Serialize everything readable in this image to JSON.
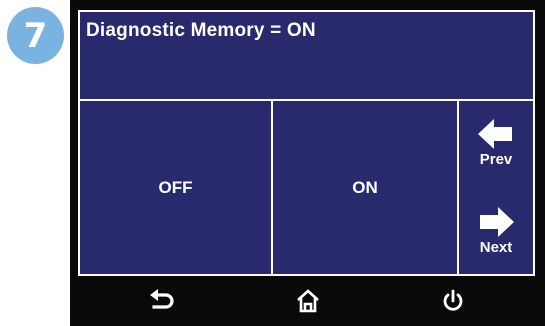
{
  "step": {
    "number": "7"
  },
  "screen": {
    "title": "Diagnostic Memory  =  ON",
    "options": {
      "off_label": "OFF",
      "on_label": "ON"
    },
    "nav": {
      "prev_label": "Prev",
      "next_label": "Next"
    }
  },
  "bottom_bar": {
    "back_icon": "back-arrow-icon",
    "home_icon": "home-icon",
    "power_icon": "power-icon"
  },
  "colors": {
    "screen_bg": "#29296e",
    "bezel": "#0a0a0a",
    "badge": "#7bb3e0",
    "text": "#ffffff"
  }
}
